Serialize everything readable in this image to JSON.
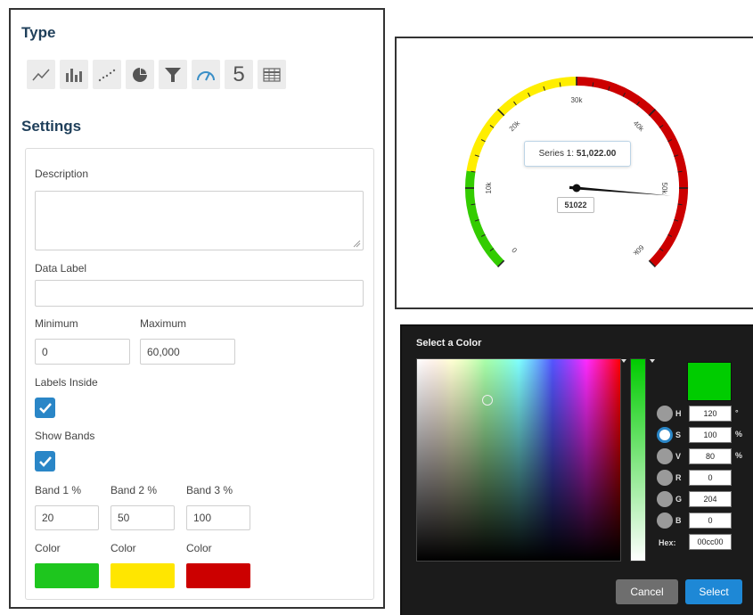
{
  "type_section": {
    "title": "Type",
    "buttons": [
      {
        "icon": "line-chart-icon"
      },
      {
        "icon": "bar-chart-icon"
      },
      {
        "icon": "scatter-chart-icon"
      },
      {
        "icon": "pie-chart-icon"
      },
      {
        "icon": "funnel-icon"
      },
      {
        "icon": "gauge-icon",
        "active": true
      },
      {
        "icon": "number-icon",
        "label": "5"
      },
      {
        "icon": "table-icon"
      }
    ]
  },
  "settings": {
    "title": "Settings",
    "description_label": "Description",
    "description_value": "",
    "data_label_label": "Data Label",
    "data_label_value": "",
    "minimum_label": "Minimum",
    "minimum_value": "0",
    "maximum_label": "Maximum",
    "maximum_value": "60,000",
    "labels_inside_label": "Labels Inside",
    "labels_inside_checked": true,
    "show_bands_label": "Show Bands",
    "show_bands_checked": true,
    "band1_label": "Band 1 %",
    "band1_value": "20",
    "band2_label": "Band 2 %",
    "band2_value": "50",
    "band3_label": "Band 3 %",
    "band3_value": "100",
    "color_label": "Color",
    "band_colors": [
      "#1ec61e",
      "#ffe600",
      "#cc0000"
    ]
  },
  "gauge": {
    "min": 0,
    "max": 60000,
    "value": 51022,
    "tick_labels": [
      "0",
      "10k",
      "20k",
      "30k",
      "40k",
      "50k",
      "60k"
    ],
    "tooltip_series": "Series 1:",
    "tooltip_value": "51,022.00",
    "value_label": "51022",
    "bands": [
      {
        "to_pct": 20,
        "color": "#33cc00"
      },
      {
        "to_pct": 50,
        "color": "#ffee00"
      },
      {
        "to_pct": 100,
        "color": "#cc0000"
      }
    ]
  },
  "color_picker": {
    "title": "Select a Color",
    "fields": [
      {
        "label": "H",
        "value": "120",
        "unit": "°"
      },
      {
        "label": "S",
        "value": "100",
        "unit": "%",
        "selected": true
      },
      {
        "label": "V",
        "value": "80",
        "unit": "%"
      },
      {
        "label": "R",
        "value": "0",
        "unit": ""
      },
      {
        "label": "G",
        "value": "204",
        "unit": ""
      },
      {
        "label": "B",
        "value": "0",
        "unit": ""
      }
    ],
    "hex_label": "Hex:",
    "hex_value": "00cc00",
    "selected_color": "#00cc00",
    "cancel_label": "Cancel",
    "select_label": "Select"
  }
}
